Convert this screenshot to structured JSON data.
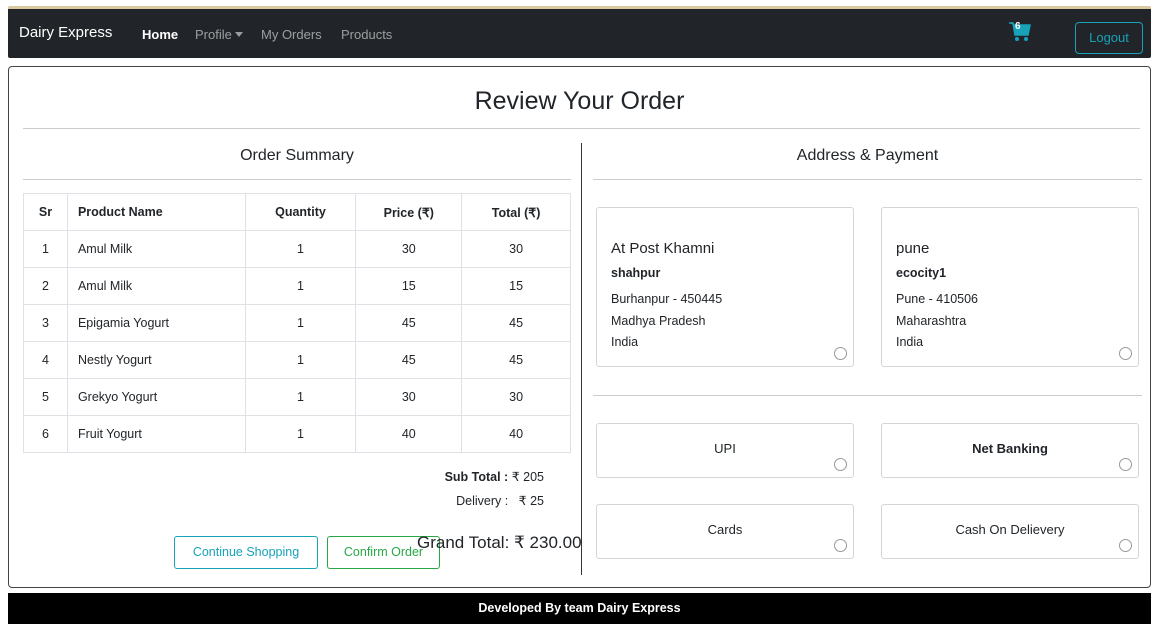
{
  "nav": {
    "brand": "Dairy Express",
    "home": "Home",
    "profile": "Profile",
    "orders": "My Orders",
    "products": "Products",
    "cart_count": "6",
    "logout": "Logout"
  },
  "page": {
    "title": "Review Your Order"
  },
  "summary": {
    "title": "Order Summary",
    "columns": [
      "Sr",
      "Product Name",
      "Quantity",
      "Price (₹)",
      "Total (₹)"
    ],
    "rows": [
      [
        "1",
        "Amul Milk",
        "1",
        "30",
        "30"
      ],
      [
        "2",
        "Amul Milk",
        "1",
        "15",
        "15"
      ],
      [
        "3",
        "Epigamia Yogurt",
        "1",
        "45",
        "45"
      ],
      [
        "4",
        "Nestly Yogurt",
        "1",
        "45",
        "45"
      ],
      [
        "5",
        "Grekyo Yogurt",
        "1",
        "30",
        "30"
      ],
      [
        "6",
        "Fruit Yogurt",
        "1",
        "40",
        "40"
      ]
    ],
    "subtotal_label": "Sub Total :",
    "subtotal_value": "₹ 205",
    "delivery_label": "Delivery :",
    "delivery_value": "₹ 25",
    "grand_total": "Grand Total: ₹ 230.00",
    "continue_label": "Continue Shopping",
    "confirm_label": "Confirm Order"
  },
  "address_payment": {
    "title": "Address & Payment",
    "addresses": [
      {
        "line1": "At Post Khamni",
        "line2": "shahpur",
        "city": "Burhanpur  -  450445",
        "state": "Madhya Pradesh",
        "country": "India"
      },
      {
        "line1": "pune",
        "line2": "ecocity1",
        "city": "Pune  -  410506",
        "state": "Maharashtra",
        "country": "India"
      }
    ],
    "payments": [
      "UPI",
      "Net Banking",
      "Cards",
      "Cash On Delievery"
    ]
  },
  "footer": {
    "text": "Developed By team Dairy Express"
  },
  "colors": {
    "navbar_bg": "#212529",
    "info": "#17a2b8",
    "success": "#28a745",
    "footer_bg": "#000000"
  }
}
